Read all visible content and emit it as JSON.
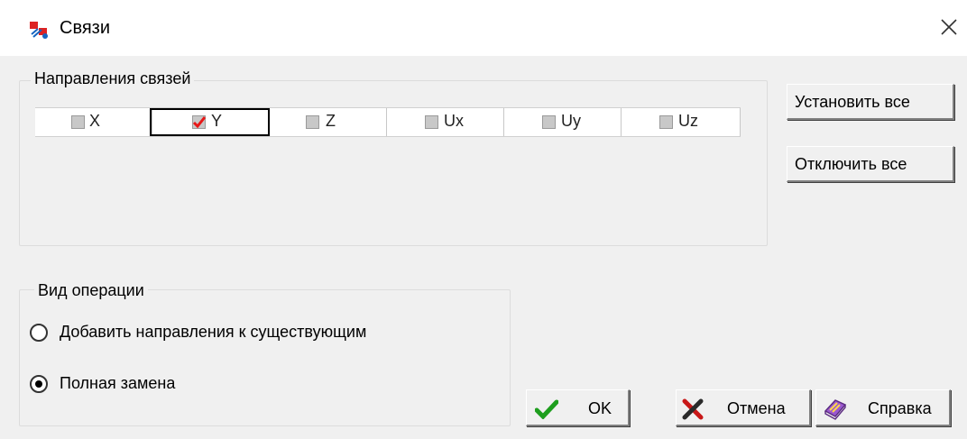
{
  "window": {
    "title": "Связи",
    "app_icon": "app-logo-icon",
    "close_icon": "close-icon"
  },
  "directions": {
    "group_label": "Направления связей",
    "items": [
      {
        "label": "X",
        "checked": false,
        "selected": false
      },
      {
        "label": "Y",
        "checked": true,
        "selected": true
      },
      {
        "label": "Z",
        "checked": false,
        "selected": false
      },
      {
        "label": "Ux",
        "checked": false,
        "selected": false
      },
      {
        "label": "Uy",
        "checked": false,
        "selected": false
      },
      {
        "label": "Uz",
        "checked": false,
        "selected": false
      }
    ]
  },
  "side_buttons": {
    "set_all": "Установить все",
    "clear_all": "Отключить все"
  },
  "operation": {
    "group_label": "Вид операции",
    "options": [
      {
        "label": "Добавить направления к существующим",
        "selected": false
      },
      {
        "label": "Полная замена",
        "selected": true
      }
    ]
  },
  "buttons": {
    "ok": "OK",
    "ok_icon": "checkmark-icon",
    "cancel": "Отмена",
    "cancel_icon": "cross-icon",
    "help": "Справка",
    "help_icon": "book-icon"
  },
  "colors": {
    "check_mark": "#e81818",
    "ok_green": "#1e9e1e",
    "cancel_dark": "#2a2a2a",
    "help_purple": "#7a3db0"
  }
}
